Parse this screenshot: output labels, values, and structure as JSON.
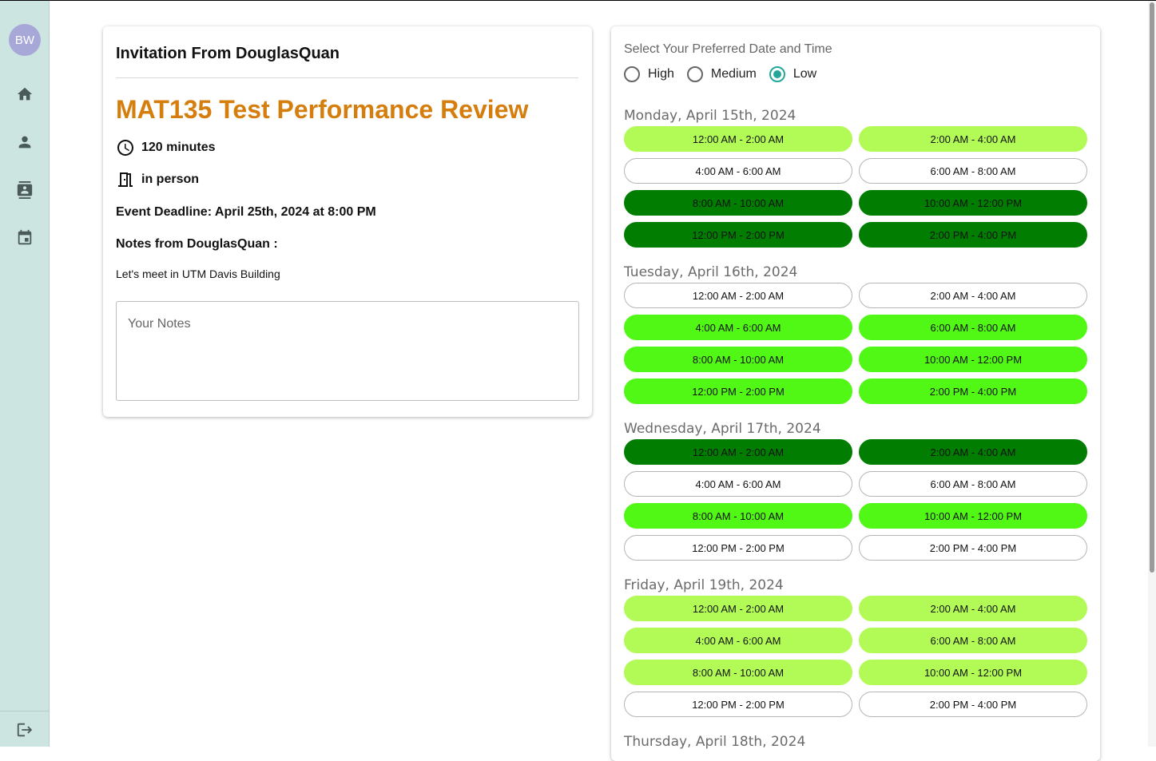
{
  "sidebar": {
    "avatar_initials": "BW",
    "items": [
      {
        "icon": "home-icon"
      },
      {
        "icon": "person-icon"
      },
      {
        "icon": "contacts-icon"
      },
      {
        "icon": "calendar-icon"
      }
    ],
    "logout_icon": "logout-icon"
  },
  "invitation": {
    "title": "Invitation From DouglasQuan",
    "event_title": "MAT135 Test Performance Review",
    "duration": "120 minutes",
    "location": "in person",
    "deadline": "Event Deadline: April 25th, 2024 at 8:00 PM",
    "notes_heading": "Notes from DouglasQuan :",
    "notes_text": "Let's meet in UTM Davis Building",
    "your_notes_placeholder": "Your Notes",
    "accent_color": "#d57e0e"
  },
  "preferences": {
    "title": "Select Your Preferred Date and Time",
    "options": [
      {
        "label": "High",
        "selected": false
      },
      {
        "label": "Medium",
        "selected": false
      },
      {
        "label": "Low",
        "selected": true
      }
    ],
    "level_colors": {
      "none": "#ffffff",
      "low": "#b2fb57",
      "medium": "#51f816",
      "high": "#017e02"
    }
  },
  "days": [
    {
      "title": "Monday, April 15th, 2024",
      "slots": [
        {
          "label": "12:00 AM - 2:00 AM",
          "level": 1
        },
        {
          "label": "2:00 AM - 4:00 AM",
          "level": 1
        },
        {
          "label": "4:00 AM - 6:00 AM",
          "level": 0
        },
        {
          "label": "6:00 AM - 8:00 AM",
          "level": 0
        },
        {
          "label": "8:00 AM - 10:00 AM",
          "level": 3
        },
        {
          "label": "10:00 AM - 12:00 PM",
          "level": 3
        },
        {
          "label": "12:00 PM - 2:00 PM",
          "level": 3
        },
        {
          "label": "2:00 PM - 4:00 PM",
          "level": 3
        }
      ]
    },
    {
      "title": "Tuesday, April 16th, 2024",
      "slots": [
        {
          "label": "12:00 AM - 2:00 AM",
          "level": 0
        },
        {
          "label": "2:00 AM - 4:00 AM",
          "level": 0
        },
        {
          "label": "4:00 AM - 6:00 AM",
          "level": 2
        },
        {
          "label": "6:00 AM - 8:00 AM",
          "level": 2
        },
        {
          "label": "8:00 AM - 10:00 AM",
          "level": 2
        },
        {
          "label": "10:00 AM - 12:00 PM",
          "level": 2
        },
        {
          "label": "12:00 PM - 2:00 PM",
          "level": 2
        },
        {
          "label": "2:00 PM - 4:00 PM",
          "level": 2
        }
      ]
    },
    {
      "title": "Wednesday, April 17th, 2024",
      "slots": [
        {
          "label": "12:00 AM - 2:00 AM",
          "level": 3
        },
        {
          "label": "2:00 AM - 4:00 AM",
          "level": 3
        },
        {
          "label": "4:00 AM - 6:00 AM",
          "level": 0
        },
        {
          "label": "6:00 AM - 8:00 AM",
          "level": 0
        },
        {
          "label": "8:00 AM - 10:00 AM",
          "level": 2
        },
        {
          "label": "10:00 AM - 12:00 PM",
          "level": 2
        },
        {
          "label": "12:00 PM - 2:00 PM",
          "level": 0
        },
        {
          "label": "2:00 PM - 4:00 PM",
          "level": 0
        }
      ]
    },
    {
      "title": "Friday, April 19th, 2024",
      "slots": [
        {
          "label": "12:00 AM - 2:00 AM",
          "level": 1
        },
        {
          "label": "2:00 AM - 4:00 AM",
          "level": 1
        },
        {
          "label": "4:00 AM - 6:00 AM",
          "level": 1
        },
        {
          "label": "6:00 AM - 8:00 AM",
          "level": 1
        },
        {
          "label": "8:00 AM - 10:00 AM",
          "level": 1
        },
        {
          "label": "10:00 AM - 12:00 PM",
          "level": 1
        },
        {
          "label": "12:00 PM - 2:00 PM",
          "level": 0
        },
        {
          "label": "2:00 PM - 4:00 PM",
          "level": 0
        }
      ]
    },
    {
      "title": "Thursday, April 18th, 2024",
      "slots": []
    }
  ]
}
